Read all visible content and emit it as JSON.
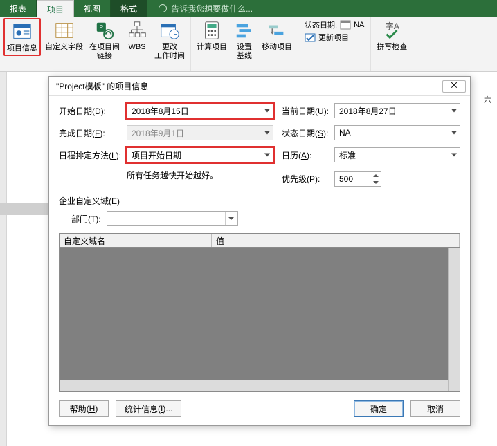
{
  "tabs": {
    "report": "报表",
    "project": "项目",
    "view": "视图",
    "format": "格式"
  },
  "tellme": "告诉我您想要做什么...",
  "ribbon": {
    "project_info": "项目信息",
    "custom_fields": "自定义字段",
    "links_between": "在项目间\n链接",
    "wbs": "WBS",
    "change_time": "更改\n工作时间",
    "calc_project": "计算项目",
    "set_baseline": "设置\n基线",
    "move_project": "移动项目",
    "status_date_lbl": "状态日期:",
    "status_date_val": "NA",
    "update_project": "更新项目",
    "spelling": "拼写检查"
  },
  "sheet": {
    "col_sat": "六"
  },
  "dialog": {
    "title": "\"Project模板\" 的项目信息",
    "close_glyph": "⨉",
    "start_date_lbl": "开始日期",
    "start_date_key": "D",
    "start_date_val": "2018年8月15日",
    "current_date_lbl": "当前日期",
    "current_date_key": "U",
    "current_date_val": "2018年8月27日",
    "finish_date_lbl": "完成日期",
    "finish_date_key": "F",
    "finish_date_val": "2018年9月1日",
    "status_date_lbl": "状态日期",
    "status_date_key": "S",
    "status_date_val": "NA",
    "schedule_from_lbl": "日程排定方法",
    "schedule_from_key": "L",
    "schedule_from_val": "项目开始日期",
    "calendar_lbl": "日历",
    "calendar_key": "A",
    "calendar_val": "标准",
    "note": "所有任务越快开始越好。",
    "priority_lbl": "优先级",
    "priority_key": "P",
    "priority_val": "500",
    "enterprise_lbl": "企业自定义域",
    "enterprise_key": "E",
    "dept_lbl": "部门",
    "dept_key": "T",
    "grid_col_name": "自定义域名",
    "grid_col_value": "值",
    "help": "帮助",
    "help_key": "H",
    "stats": "统计信息",
    "stats_key": "I",
    "ok": "确定",
    "cancel": "取消"
  }
}
